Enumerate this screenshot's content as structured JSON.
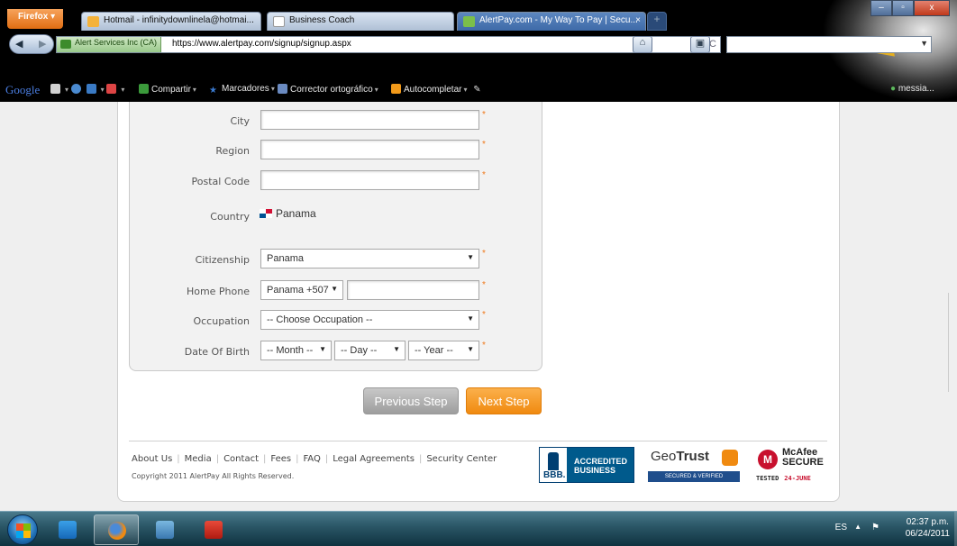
{
  "browser": {
    "app_button": "Firefox",
    "tabs": [
      {
        "label": "Hotmail - infinitydownlinela@hotmai...",
        "active": false
      },
      {
        "label": "Business Coach",
        "active": false
      },
      {
        "label": "AlertPay.com - My Way To Pay | Secu...",
        "active": true
      }
    ],
    "identity": "Alert Services Inc (CA)",
    "url": "https://www.alertpay.com/signup/signup.aspx",
    "search_value": ""
  },
  "google_toolbar": {
    "logo": "Google",
    "items": [
      "Compartir",
      "Marcadores",
      "Corrector ortográfico",
      "Autocompletar"
    ],
    "user": "messia..."
  },
  "form": {
    "city": {
      "label": "City",
      "value": ""
    },
    "region": {
      "label": "Region",
      "value": ""
    },
    "postal_code": {
      "label": "Postal Code",
      "value": ""
    },
    "country": {
      "label": "Country",
      "value": "Panama"
    },
    "citizenship": {
      "label": "Citizenship",
      "value": "Panama"
    },
    "home_phone": {
      "label": "Home Phone",
      "country_code": "Panama +507",
      "value": ""
    },
    "occupation": {
      "label": "Occupation",
      "value": "-- Choose Occupation --"
    },
    "dob": {
      "label": "Date Of Birth",
      "month": "-- Month --",
      "day": "-- Day --",
      "year": "-- Year --"
    },
    "required_mark": "*"
  },
  "buttons": {
    "previous": "Previous Step",
    "next": "Next Step"
  },
  "footer": {
    "links": [
      "About Us",
      "Media",
      "Contact",
      "Fees",
      "FAQ",
      "Legal Agreements",
      "Security Center"
    ],
    "copyright": "Copyright 2011 AlertPay All Rights Reserved."
  },
  "badges": {
    "bbb": {
      "logo": "BBB.",
      "line1": "ACCREDITED",
      "line2": "BUSINESS"
    },
    "geotrust": {
      "name_prefix": "Geo",
      "name_bold": "Trust",
      "tag": "SECURED & VERIFIED"
    },
    "mcafee": {
      "brand1": "McAfee",
      "brand2": "SECURE",
      "tested": "TESTED",
      "date": "24-JUNE"
    }
  },
  "taskbar": {
    "language": "ES",
    "time": "02:37 p.m.",
    "date": "06/24/2011"
  },
  "colors": {
    "accent_orange": "#f08a10",
    "required": "#f07a1c",
    "taskbar": "#2c5868"
  }
}
